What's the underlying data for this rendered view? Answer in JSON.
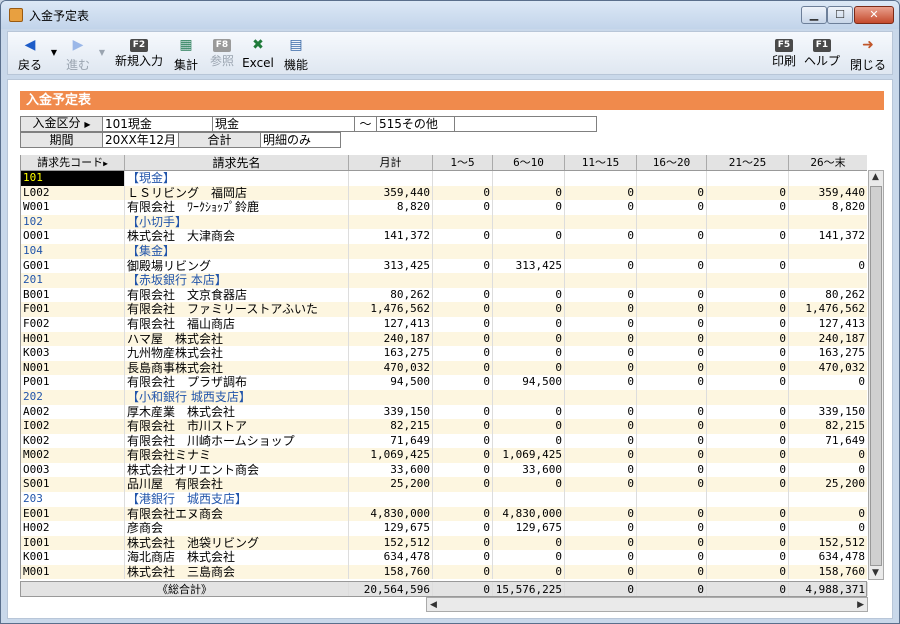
{
  "window": {
    "title": "入金予定表"
  },
  "toolbar": {
    "back": "戻る",
    "forward": "進む",
    "new_entry": "新規入力",
    "new_entry_key": "F2",
    "aggregate": "集計",
    "aggregate_key": "F3",
    "reference": "参照",
    "reference_key": "F8",
    "excel": "Excel",
    "function": "機能",
    "print": "印刷",
    "print_key": "F5",
    "help": "ヘルプ",
    "help_key": "F1",
    "close": "閉じる"
  },
  "header_title": "入金予定表",
  "criteria": {
    "kubun_label": "入金区分",
    "from_code": "101",
    "from_name": "現金",
    "from_name2": "現金",
    "tilde": "～",
    "to_code": "515",
    "to_name": "その他",
    "period_label": "期間",
    "period_value": "20XX年12月",
    "total_label": "合計",
    "total_value": "明細のみ"
  },
  "columns": [
    "請求先コード",
    "請求先名",
    "月計",
    "1～5",
    "6～10",
    "11～15",
    "16～20",
    "21～25",
    "26～末"
  ],
  "rows": [
    {
      "code": "101",
      "name": "【現金】",
      "group": true,
      "vals": []
    },
    {
      "code": "L002",
      "name": "ＬＳリビング　福岡店",
      "vals": [
        "359,440",
        "0",
        "0",
        "0",
        "0",
        "0",
        "359,440"
      ]
    },
    {
      "code": "W001",
      "name": "有限会社　ﾜｰｸｼｮｯﾌﾟ鈴鹿",
      "vals": [
        "8,820",
        "0",
        "0",
        "0",
        "0",
        "0",
        "8,820"
      ]
    },
    {
      "code": "102",
      "name": "【小切手】",
      "group": true,
      "vals": []
    },
    {
      "code": "O001",
      "name": "株式会社　大津商会",
      "vals": [
        "141,372",
        "0",
        "0",
        "0",
        "0",
        "0",
        "141,372"
      ]
    },
    {
      "code": "104",
      "name": "【集金】",
      "group": true,
      "vals": []
    },
    {
      "code": "G001",
      "name": "御殿場リビング",
      "vals": [
        "313,425",
        "0",
        "313,425",
        "0",
        "0",
        "0",
        "0"
      ]
    },
    {
      "code": "201",
      "name": "【赤坂銀行 本店】",
      "group": true,
      "vals": []
    },
    {
      "code": "B001",
      "name": "有限会社　文京食器店",
      "vals": [
        "80,262",
        "0",
        "0",
        "0",
        "0",
        "0",
        "80,262"
      ]
    },
    {
      "code": "F001",
      "name": "有限会社　ファミリーストアふいた",
      "vals": [
        "1,476,562",
        "0",
        "0",
        "0",
        "0",
        "0",
        "1,476,562"
      ]
    },
    {
      "code": "F002",
      "name": "有限会社　福山商店",
      "vals": [
        "127,413",
        "0",
        "0",
        "0",
        "0",
        "0",
        "127,413"
      ]
    },
    {
      "code": "H001",
      "name": "ハマ屋　株式会社",
      "vals": [
        "240,187",
        "0",
        "0",
        "0",
        "0",
        "0",
        "240,187"
      ]
    },
    {
      "code": "K003",
      "name": "九州物産株式会社",
      "vals": [
        "163,275",
        "0",
        "0",
        "0",
        "0",
        "0",
        "163,275"
      ]
    },
    {
      "code": "N001",
      "name": "長島商事株式会社",
      "vals": [
        "470,032",
        "0",
        "0",
        "0",
        "0",
        "0",
        "470,032"
      ]
    },
    {
      "code": "P001",
      "name": "有限会社　プラザ調布",
      "vals": [
        "94,500",
        "0",
        "94,500",
        "0",
        "0",
        "0",
        "0"
      ]
    },
    {
      "code": "202",
      "name": "【小和銀行 城西支店】",
      "group": true,
      "vals": []
    },
    {
      "code": "A002",
      "name": "厚木産業　株式会社",
      "vals": [
        "339,150",
        "0",
        "0",
        "0",
        "0",
        "0",
        "339,150"
      ]
    },
    {
      "code": "I002",
      "name": "有限会社　市川ストア",
      "vals": [
        "82,215",
        "0",
        "0",
        "0",
        "0",
        "0",
        "82,215"
      ]
    },
    {
      "code": "K002",
      "name": "有限会社　川崎ホームショップ",
      "vals": [
        "71,649",
        "0",
        "0",
        "0",
        "0",
        "0",
        "71,649"
      ]
    },
    {
      "code": "M002",
      "name": "有限会社ミナミ",
      "vals": [
        "1,069,425",
        "0",
        "1,069,425",
        "0",
        "0",
        "0",
        "0"
      ]
    },
    {
      "code": "O003",
      "name": "株式会社オリエント商会",
      "vals": [
        "33,600",
        "0",
        "33,600",
        "0",
        "0",
        "0",
        "0"
      ]
    },
    {
      "code": "S001",
      "name": "品川屋　有限会社",
      "vals": [
        "25,200",
        "0",
        "0",
        "0",
        "0",
        "0",
        "25,200"
      ]
    },
    {
      "code": "203",
      "name": "【港銀行　城西支店】",
      "group": true,
      "vals": []
    },
    {
      "code": "E001",
      "name": "有限会社エヌ商会",
      "vals": [
        "4,830,000",
        "0",
        "4,830,000",
        "0",
        "0",
        "0",
        "0"
      ]
    },
    {
      "code": "H002",
      "name": "彦商会",
      "vals": [
        "129,675",
        "0",
        "129,675",
        "0",
        "0",
        "0",
        "0"
      ]
    },
    {
      "code": "I001",
      "name": "株式会社　池袋リビング",
      "vals": [
        "152,512",
        "0",
        "0",
        "0",
        "0",
        "0",
        "152,512"
      ]
    },
    {
      "code": "K001",
      "name": "海北商店　株式会社",
      "vals": [
        "634,478",
        "0",
        "0",
        "0",
        "0",
        "0",
        "634,478"
      ]
    },
    {
      "code": "M001",
      "name": "株式会社　三島商会",
      "vals": [
        "158,760",
        "0",
        "0",
        "0",
        "0",
        "0",
        "158,760"
      ]
    }
  ],
  "total": {
    "label": "《総合計》",
    "vals": [
      "20,564,596",
      "0",
      "15,576,225",
      "0",
      "0",
      "0",
      "4,988,371"
    ]
  }
}
